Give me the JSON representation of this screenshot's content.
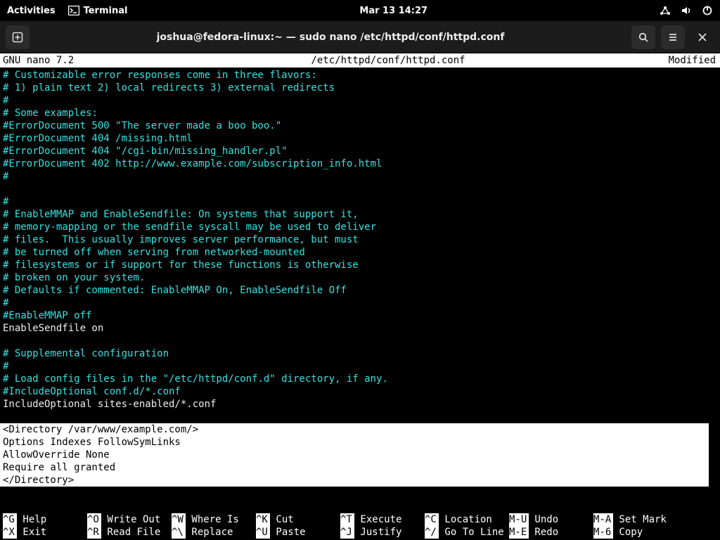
{
  "topbar": {
    "activities": "Activities",
    "app": "Terminal",
    "clock": "Mar 13  14:27"
  },
  "titlebar": {
    "title": "joshua@fedora-linux:~ — sudo nano /etc/httpd/conf/httpd.conf"
  },
  "nanobar": {
    "left": "  GNU nano 7.2",
    "center": "/etc/httpd/conf/httpd.conf",
    "right": "Modified "
  },
  "lines": [
    {
      "t": "# Customizable error responses come in three flavors:",
      "c": "c"
    },
    {
      "t": "# 1) plain text 2) local redirects 3) external redirects",
      "c": "c"
    },
    {
      "t": "#",
      "c": "c"
    },
    {
      "t": "# Some examples:",
      "c": "c"
    },
    {
      "t": "#ErrorDocument 500 \"The server made a boo boo.\"",
      "c": "c"
    },
    {
      "t": "#ErrorDocument 404 /missing.html",
      "c": "c"
    },
    {
      "t": "#ErrorDocument 404 \"/cgi-bin/missing_handler.pl\"",
      "c": "c"
    },
    {
      "t": "#ErrorDocument 402 http://www.example.com/subscription_info.html",
      "c": "c"
    },
    {
      "t": "#",
      "c": "c"
    },
    {
      "t": "",
      "c": "p"
    },
    {
      "t": "#",
      "c": "c"
    },
    {
      "t": "# EnableMMAP and EnableSendfile: On systems that support it,",
      "c": "c"
    },
    {
      "t": "# memory-mapping or the sendfile syscall may be used to deliver",
      "c": "c"
    },
    {
      "t": "# files.  This usually improves server performance, but must",
      "c": "c"
    },
    {
      "t": "# be turned off when serving from networked-mounted",
      "c": "c"
    },
    {
      "t": "# filesystems or if support for these functions is otherwise",
      "c": "c"
    },
    {
      "t": "# broken on your system.",
      "c": "c"
    },
    {
      "t": "# Defaults if commented: EnableMMAP On, EnableSendfile Off",
      "c": "c"
    },
    {
      "t": "#",
      "c": "c"
    },
    {
      "t": "#EnableMMAP off",
      "c": "c"
    },
    {
      "t": "EnableSendfile on",
      "c": "p"
    },
    {
      "t": "",
      "c": "p"
    },
    {
      "t": "# Supplemental configuration",
      "c": "c"
    },
    {
      "t": "#",
      "c": "c"
    },
    {
      "t": "# Load config files in the \"/etc/httpd/conf.d\" directory, if any.",
      "c": "c"
    },
    {
      "t": "#IncludeOptional conf.d/*.conf",
      "c": "c"
    },
    {
      "t": "IncludeOptional sites-enabled/*.conf",
      "c": "p"
    },
    {
      "t": "",
      "c": "p"
    },
    {
      "t": "<Directory /var/www/example.com/>",
      "c": "h"
    },
    {
      "t": "Options Indexes FollowSymLinks",
      "c": "h"
    },
    {
      "t": "AllowOverride None",
      "c": "h"
    },
    {
      "t": "Require all granted",
      "c": "h"
    },
    {
      "t": "</Directory>",
      "c": "h"
    }
  ],
  "help": [
    [
      {
        "k": "^G",
        "l": "Help"
      },
      {
        "k": "^O",
        "l": "Write Out"
      },
      {
        "k": "^W",
        "l": "Where Is"
      },
      {
        "k": "^K",
        "l": "Cut"
      },
      {
        "k": "^T",
        "l": "Execute"
      },
      {
        "k": "^C",
        "l": "Location"
      },
      {
        "k": "M-U",
        "l": "Undo"
      },
      {
        "k": "M-A",
        "l": "Set Mark"
      }
    ],
    [
      {
        "k": "^X",
        "l": "Exit"
      },
      {
        "k": "^R",
        "l": "Read File"
      },
      {
        "k": "^\\",
        "l": "Replace"
      },
      {
        "k": "^U",
        "l": "Paste"
      },
      {
        "k": "^J",
        "l": "Justify"
      },
      {
        "k": "^/",
        "l": "Go To Line"
      },
      {
        "k": "M-E",
        "l": "Redo"
      },
      {
        "k": "M-6",
        "l": "Copy"
      }
    ]
  ],
  "help_col_widths": [
    120,
    120,
    120,
    120,
    120,
    120,
    120,
    120
  ]
}
